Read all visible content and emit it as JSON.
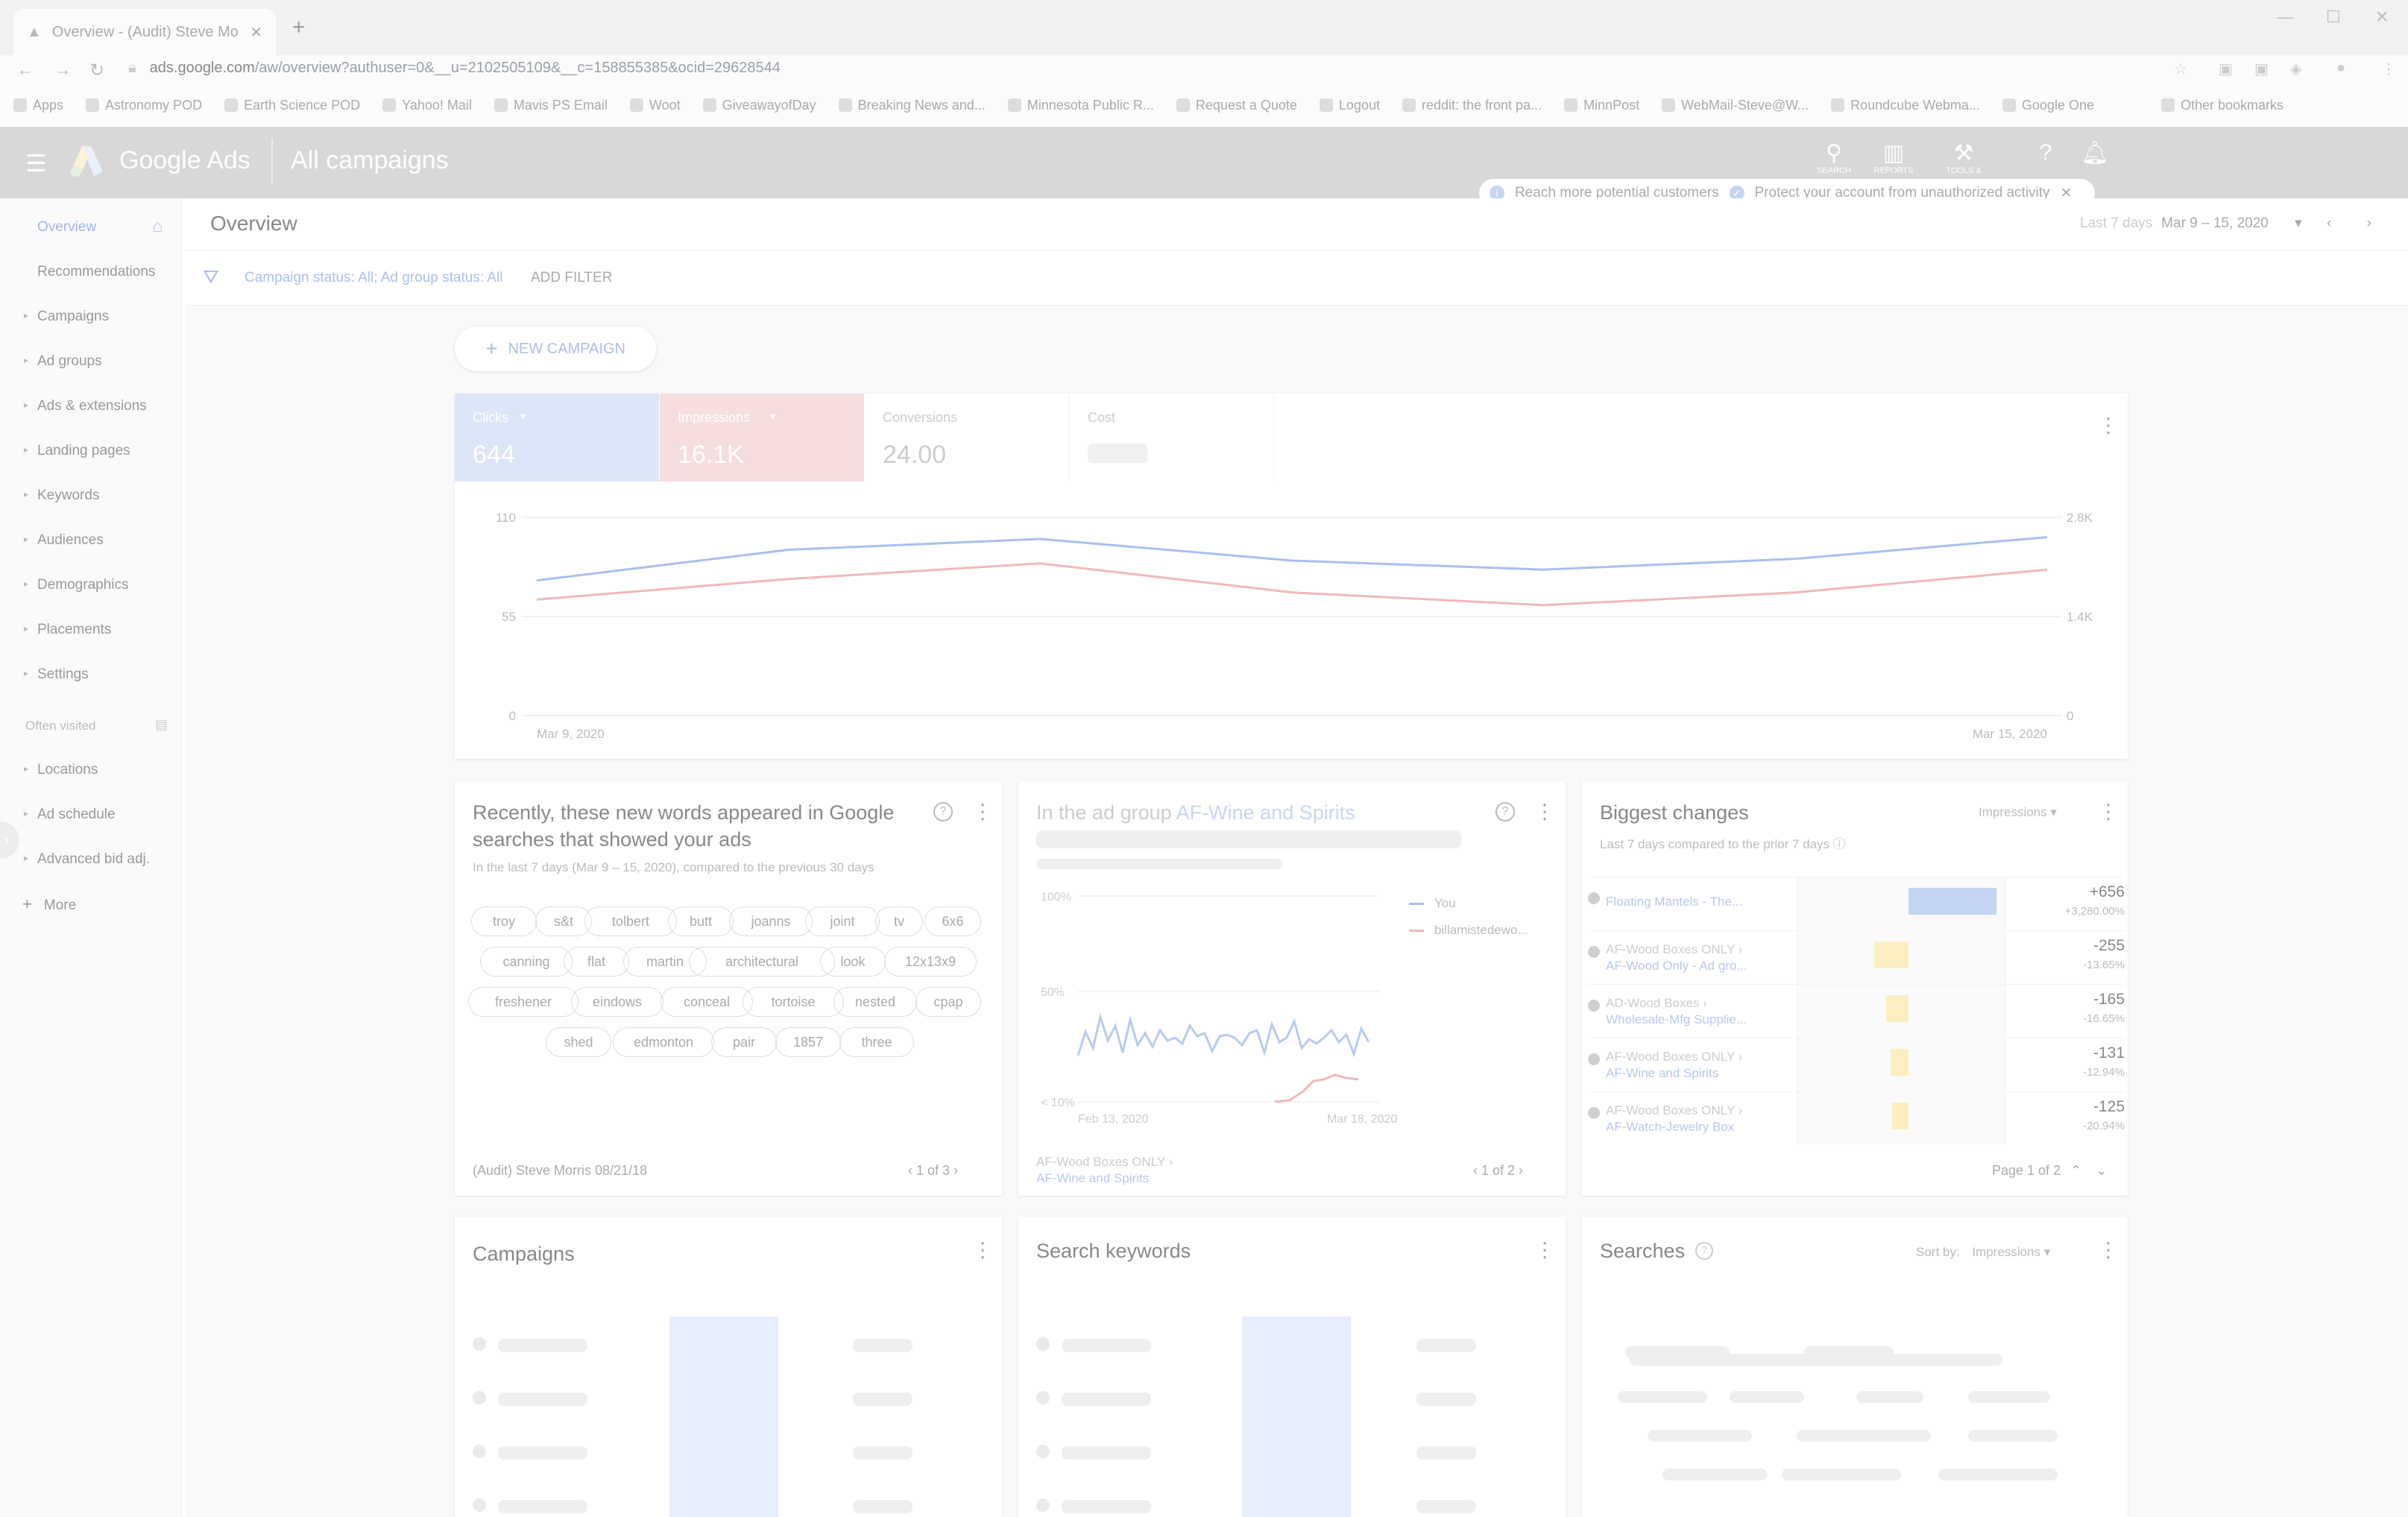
{
  "browser": {
    "tab_title": "Overview - (Audit) Steve Morris",
    "url_host": "ads.google.com",
    "url_path": "/aw/overview?authuser=0&__u=2102505109&__c=158855385&ocid=29628544",
    "bookmarks": [
      "Apps",
      "Astronomy POD",
      "Earth Science POD",
      "Yahoo! Mail",
      "Mavis PS Email",
      "Woot",
      "GiveawayofDay",
      "Breaking News and...",
      "Minnesota Public R...",
      "Request a Quote",
      "Logout",
      "reddit: the front pa...",
      "MinnPost",
      "WebMail-Steve@W...",
      "Roundcube Webma...",
      "Google One",
      "Other bookmarks"
    ]
  },
  "app": {
    "brand": "Google Ads",
    "section": "All campaigns",
    "top_icons": [
      {
        "icon": "search-icon",
        "label": "SEARCH"
      },
      {
        "icon": "reports-icon",
        "label": "REPORTS"
      },
      {
        "icon": "tools-icon",
        "label": "TOOLS &"
      }
    ],
    "notices": [
      "Reach more potential customers",
      "Protect your account from unauthorized activity"
    ]
  },
  "sidebar": {
    "items": [
      "Overview",
      "Recommendations",
      "Campaigns",
      "Ad groups",
      "Ads & extensions",
      "Landing pages",
      "Keywords",
      "Audiences",
      "Demographics",
      "Placements",
      "Settings"
    ],
    "often_visited_label": "Often visited",
    "often_items": [
      "Locations",
      "Ad schedule",
      "Advanced bid adj."
    ],
    "more": "More"
  },
  "header": {
    "title": "Overview",
    "date_label": "Last 7 days",
    "date_range": "Mar 9 – 15, 2020",
    "filter_text": "Campaign status: All; Ad group status: All",
    "add_filter": "ADD FILTER",
    "new_campaign": "NEW CAMPAIGN"
  },
  "metrics": [
    {
      "label": "Clicks",
      "value": "644",
      "color": "#dde6f8"
    },
    {
      "label": "Impressions",
      "value": "16.1K",
      "color": "#f6dede"
    },
    {
      "label": "Conversions",
      "value": "24.00",
      "color": "#ffffff"
    },
    {
      "label": "Cost",
      "value": "",
      "color": "#ffffff"
    }
  ],
  "chart_data": {
    "type": "line",
    "x": [
      "Mar 9, 2020",
      "Mar 10",
      "Mar 11",
      "Mar 12",
      "Mar 13",
      "Mar 14",
      "Mar 15, 2020"
    ],
    "series": [
      {
        "values": [
          75,
          92,
          98,
          86,
          81,
          87,
          99
        ],
        "color": "#a9c0ee"
      },
      {
        "values": [
          1640,
          1930,
          2150,
          1740,
          1560,
          1740,
          2060
        ],
        "color": "#f2b8b8"
      }
    ],
    "y_left_ticks": [
      "110",
      "55",
      "0"
    ],
    "y_right_ticks": [
      "2.8K",
      "1.4K",
      "0"
    ],
    "x_labels": [
      "Mar 9, 2020",
      "Mar 15, 2020"
    ],
    "ylim_left": [
      0,
      110
    ],
    "ylim_right": [
      0,
      2800
    ]
  },
  "words_card": {
    "title": "Recently, these new words appeared in Google searches that showed your ads",
    "subtitle": "In the last 7 days (Mar 9 – 15, 2020), compared to the previous 30 days",
    "chips": [
      "troy",
      "s&t",
      "tolbert",
      "butt",
      "joanns",
      "joint",
      "tv",
      "6x6",
      "canning",
      "flat",
      "martin",
      "architectural",
      "look",
      "12x13x9",
      "freshener",
      "eindows",
      "conceal",
      "tortoise",
      "nested",
      "cpap",
      "shed",
      "edmonton",
      "pair",
      "1857",
      "three"
    ],
    "footer": "(Audit) Steve Morris 08/21/18",
    "pager": "1 of 3"
  },
  "auction_card": {
    "title_a": "In the ad group",
    "title_link": "AF-Wine and Spirits",
    "legend": [
      "You",
      "billamistedewo..."
    ],
    "y_ticks": [
      "100%",
      "50%",
      "< 10%"
    ],
    "x_labels": [
      "Feb 13, 2020",
      "Mar 18, 2020"
    ],
    "footer_parent": "AF-Wood Boxes ONLY ›",
    "footer_child": "AF-Wine and Spirits",
    "pager": "1 of 2"
  },
  "biggest_changes": {
    "title": "Biggest changes",
    "subtitle": "Last 7 days compared to the prior 7 days",
    "metric": "Impressions",
    "rows": [
      {
        "parent": "",
        "name": "Floating Mantels - The...",
        "delta": "+656",
        "pct": "+3,280.00%",
        "color": "#c4d4f3",
        "share": 1.0,
        "positive": true
      },
      {
        "parent": "AF-Wood Boxes ONLY ›",
        "name": "AF-Wood Only - Ad gro...",
        "delta": "-255",
        "pct": "-13.65%",
        "color": "#fdeec1",
        "share": 0.39,
        "positive": false
      },
      {
        "parent": "AD-Wood Boxes ›",
        "name": "Wholesale-Mfg Supplie...",
        "delta": "-165",
        "pct": "-16.65%",
        "color": "#fdeec1",
        "share": 0.25,
        "positive": false
      },
      {
        "parent": "AF-Wood Boxes ONLY ›",
        "name": "AF-Wine and Spirits",
        "delta": "-131",
        "pct": "-12.94%",
        "color": "#fdeec1",
        "share": 0.2,
        "positive": false
      },
      {
        "parent": "AF-Wood Boxes ONLY ›",
        "name": "AF-Watch-Jewelry Box",
        "delta": "-125",
        "pct": "-20.94%",
        "color": "#fdeec1",
        "share": 0.19,
        "positive": false
      }
    ],
    "pager": "Page 1 of 2"
  },
  "bottom_cards": {
    "campaigns": "Campaigns",
    "keywords": "Search keywords",
    "searches": "Searches",
    "sort_by": "Sort by:",
    "sort_metric": "Impressions"
  }
}
